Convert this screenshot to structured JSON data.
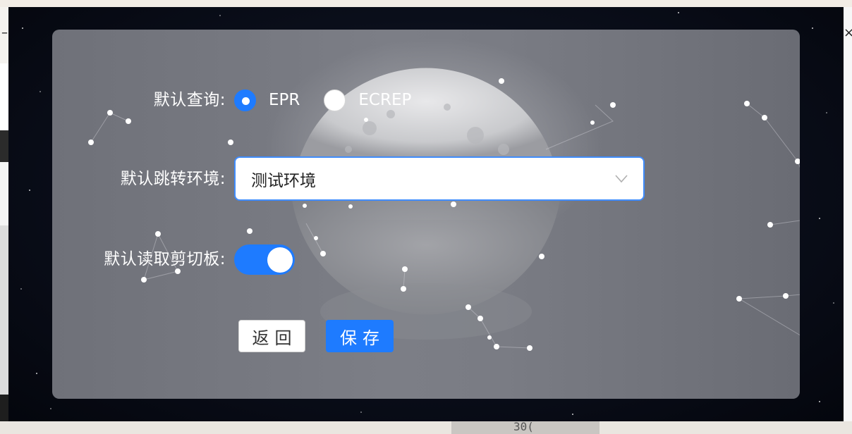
{
  "window": {
    "left_glyph": "–",
    "right_glyph": "×",
    "bottom_glyph": "30("
  },
  "form": {
    "query": {
      "label": "默认查询:",
      "options": [
        {
          "label": "EPR",
          "checked": true
        },
        {
          "label": "ECREP",
          "checked": false
        }
      ]
    },
    "environment": {
      "label": "默认跳转环境:",
      "value": "测试环境",
      "icon": "chevron-down-icon"
    },
    "clipboard": {
      "label": "默认读取剪切板:",
      "enabled": true
    }
  },
  "actions": {
    "back_label": "返回",
    "save_label": "保存"
  },
  "colors": {
    "accent": "#1e7bff",
    "panel": "#76787f",
    "background": "#070a14"
  }
}
